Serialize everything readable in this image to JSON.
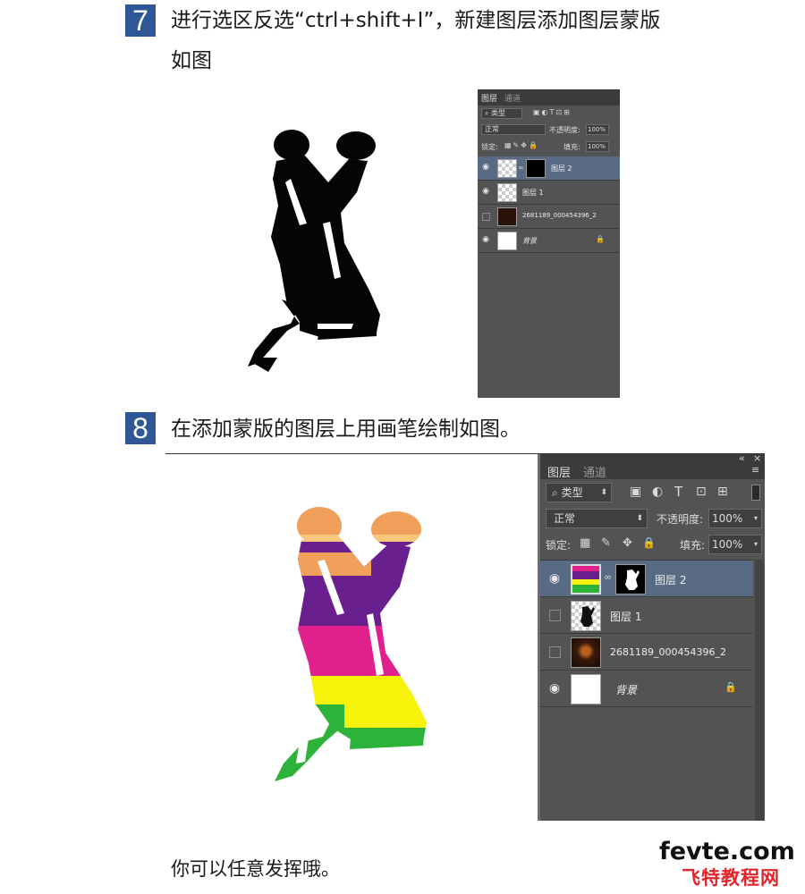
{
  "step7": {
    "number": "7",
    "line1": "进行选区反选“ctrl+shift+I”，新建图层添加图层蒙版",
    "line2": "如图"
  },
  "step8": {
    "number": "8",
    "text": "在添加蒙版的图层上用画笔绘制如图。"
  },
  "panel": {
    "tab_layers": "图层",
    "tab_channels": "通道",
    "filter_kind": "类型",
    "blend_mode": "正常",
    "opacity_label": "不透明度:",
    "opacity_value": "100%",
    "lock_label": "锁定:",
    "fill_label": "填充:",
    "fill_value": "100%",
    "collapse_glyph": "«",
    "close_glyph": "×",
    "menu_glyph": "≡",
    "layers": [
      {
        "name": "图层 2",
        "visible": true,
        "selected": true,
        "has_mask": true
      },
      {
        "name": "图层 1",
        "visible": true,
        "selected": false,
        "has_mask": false
      },
      {
        "name": "2681189_000454396_2",
        "visible": false,
        "selected": false,
        "has_mask": false
      },
      {
        "name": "背景",
        "visible": true,
        "selected": false,
        "has_mask": false,
        "locked": true
      }
    ]
  },
  "layers_small": [
    {
      "name": "图层 2",
      "visible": true
    },
    {
      "name": "图层 1",
      "visible": true
    },
    {
      "name": "2681189_000454396_2",
      "visible": false
    },
    {
      "name": "背景",
      "visible": true
    }
  ],
  "caption": "你可以任意发挥哦。",
  "watermark": {
    "domain": "fevte.com",
    "cn": "飞特教程网"
  },
  "colors": {
    "badge": "#2f5796",
    "panel_bg": "#535353",
    "selected_row": "#596a85",
    "paint_orange": "#f0a05a",
    "paint_purple": "#6a1f8f",
    "paint_pink": "#e0208c",
    "paint_yellow": "#f6f20a",
    "paint_green": "#2db23a"
  }
}
